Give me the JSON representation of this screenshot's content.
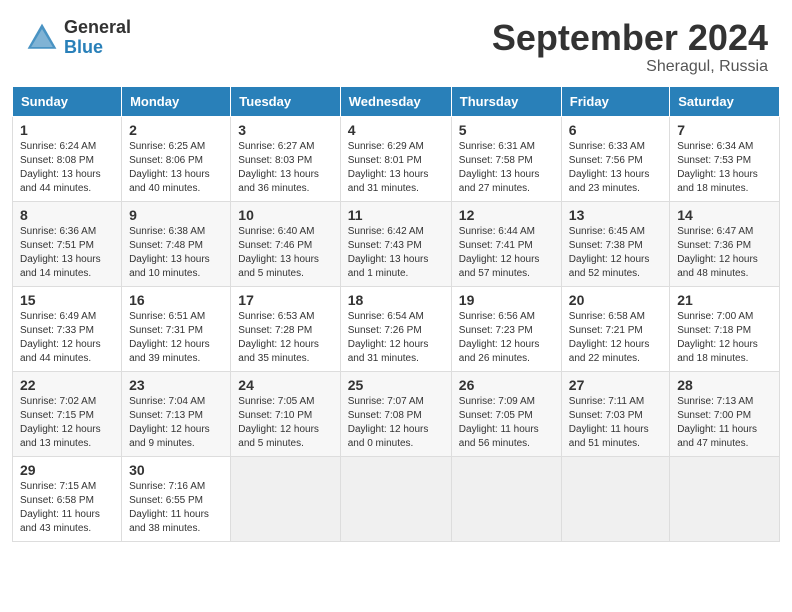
{
  "header": {
    "logo_general": "General",
    "logo_blue": "Blue",
    "month_title": "September 2024",
    "location": "Sheragul, Russia"
  },
  "weekdays": [
    "Sunday",
    "Monday",
    "Tuesday",
    "Wednesday",
    "Thursday",
    "Friday",
    "Saturday"
  ],
  "weeks": [
    [
      {
        "day": "1",
        "sunrise": "6:24 AM",
        "sunset": "8:08 PM",
        "daylight": "13 hours and 44 minutes."
      },
      {
        "day": "2",
        "sunrise": "6:25 AM",
        "sunset": "8:06 PM",
        "daylight": "13 hours and 40 minutes."
      },
      {
        "day": "3",
        "sunrise": "6:27 AM",
        "sunset": "8:03 PM",
        "daylight": "13 hours and 36 minutes."
      },
      {
        "day": "4",
        "sunrise": "6:29 AM",
        "sunset": "8:01 PM",
        "daylight": "13 hours and 31 minutes."
      },
      {
        "day": "5",
        "sunrise": "6:31 AM",
        "sunset": "7:58 PM",
        "daylight": "13 hours and 27 minutes."
      },
      {
        "day": "6",
        "sunrise": "6:33 AM",
        "sunset": "7:56 PM",
        "daylight": "13 hours and 23 minutes."
      },
      {
        "day": "7",
        "sunrise": "6:34 AM",
        "sunset": "7:53 PM",
        "daylight": "13 hours and 18 minutes."
      }
    ],
    [
      {
        "day": "8",
        "sunrise": "6:36 AM",
        "sunset": "7:51 PM",
        "daylight": "13 hours and 14 minutes."
      },
      {
        "day": "9",
        "sunrise": "6:38 AM",
        "sunset": "7:48 PM",
        "daylight": "13 hours and 10 minutes."
      },
      {
        "day": "10",
        "sunrise": "6:40 AM",
        "sunset": "7:46 PM",
        "daylight": "13 hours and 5 minutes."
      },
      {
        "day": "11",
        "sunrise": "6:42 AM",
        "sunset": "7:43 PM",
        "daylight": "13 hours and 1 minute."
      },
      {
        "day": "12",
        "sunrise": "6:44 AM",
        "sunset": "7:41 PM",
        "daylight": "12 hours and 57 minutes."
      },
      {
        "day": "13",
        "sunrise": "6:45 AM",
        "sunset": "7:38 PM",
        "daylight": "12 hours and 52 minutes."
      },
      {
        "day": "14",
        "sunrise": "6:47 AM",
        "sunset": "7:36 PM",
        "daylight": "12 hours and 48 minutes."
      }
    ],
    [
      {
        "day": "15",
        "sunrise": "6:49 AM",
        "sunset": "7:33 PM",
        "daylight": "12 hours and 44 minutes."
      },
      {
        "day": "16",
        "sunrise": "6:51 AM",
        "sunset": "7:31 PM",
        "daylight": "12 hours and 39 minutes."
      },
      {
        "day": "17",
        "sunrise": "6:53 AM",
        "sunset": "7:28 PM",
        "daylight": "12 hours and 35 minutes."
      },
      {
        "day": "18",
        "sunrise": "6:54 AM",
        "sunset": "7:26 PM",
        "daylight": "12 hours and 31 minutes."
      },
      {
        "day": "19",
        "sunrise": "6:56 AM",
        "sunset": "7:23 PM",
        "daylight": "12 hours and 26 minutes."
      },
      {
        "day": "20",
        "sunrise": "6:58 AM",
        "sunset": "7:21 PM",
        "daylight": "12 hours and 22 minutes."
      },
      {
        "day": "21",
        "sunrise": "7:00 AM",
        "sunset": "7:18 PM",
        "daylight": "12 hours and 18 minutes."
      }
    ],
    [
      {
        "day": "22",
        "sunrise": "7:02 AM",
        "sunset": "7:15 PM",
        "daylight": "12 hours and 13 minutes."
      },
      {
        "day": "23",
        "sunrise": "7:04 AM",
        "sunset": "7:13 PM",
        "daylight": "12 hours and 9 minutes."
      },
      {
        "day": "24",
        "sunrise": "7:05 AM",
        "sunset": "7:10 PM",
        "daylight": "12 hours and 5 minutes."
      },
      {
        "day": "25",
        "sunrise": "7:07 AM",
        "sunset": "7:08 PM",
        "daylight": "12 hours and 0 minutes."
      },
      {
        "day": "26",
        "sunrise": "7:09 AM",
        "sunset": "7:05 PM",
        "daylight": "11 hours and 56 minutes."
      },
      {
        "day": "27",
        "sunrise": "7:11 AM",
        "sunset": "7:03 PM",
        "daylight": "11 hours and 51 minutes."
      },
      {
        "day": "28",
        "sunrise": "7:13 AM",
        "sunset": "7:00 PM",
        "daylight": "11 hours and 47 minutes."
      }
    ],
    [
      {
        "day": "29",
        "sunrise": "7:15 AM",
        "sunset": "6:58 PM",
        "daylight": "11 hours and 43 minutes."
      },
      {
        "day": "30",
        "sunrise": "7:16 AM",
        "sunset": "6:55 PM",
        "daylight": "11 hours and 38 minutes."
      },
      null,
      null,
      null,
      null,
      null
    ]
  ]
}
